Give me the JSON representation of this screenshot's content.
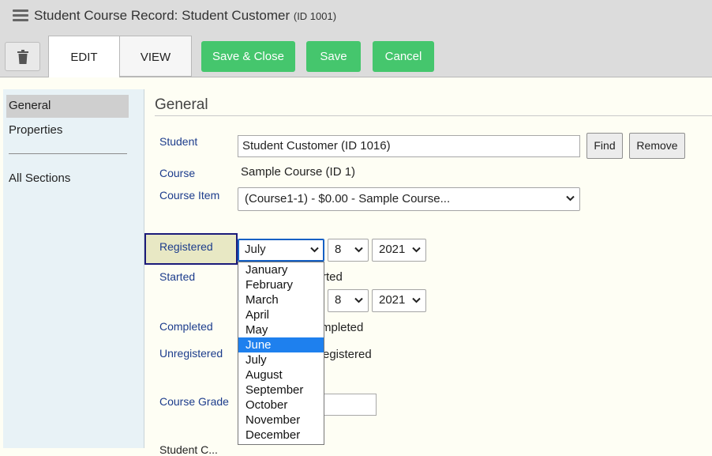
{
  "window": {
    "title": "Student Course Record: Student Customer",
    "title_id": "(ID 1001)"
  },
  "toolbar": {
    "tabs": [
      {
        "label": "EDIT",
        "active": true
      },
      {
        "label": "VIEW",
        "active": false
      }
    ],
    "save_close_label": "Save & Close",
    "save_label": "Save",
    "cancel_label": "Cancel",
    "accent_color": "#45c66d"
  },
  "sidebar": {
    "items": [
      {
        "label": "General",
        "active": true
      },
      {
        "label": "Properties",
        "active": false
      },
      {
        "label": "All Sections",
        "active": false
      }
    ]
  },
  "main": {
    "section_title": "General",
    "student": {
      "label": "Student",
      "value": "Student Customer (ID 1016)",
      "find_label": "Find",
      "remove_label": "Remove"
    },
    "course": {
      "label": "Course",
      "value": "Sample Course (ID 1)"
    },
    "course_item": {
      "label": "Course Item",
      "value": "(Course1-1) - $0.00 - Sample Course..."
    },
    "registered": {
      "label": "Registered",
      "month": "July",
      "day": "8",
      "year": "2021"
    },
    "started": {
      "label": "Started",
      "status_fragment": "rted",
      "day": "8",
      "year": "2021"
    },
    "completed": {
      "label": "Completed",
      "status_fragment": "mpleted"
    },
    "unregistered": {
      "label": "Unregistered",
      "status_fragment": "egistered"
    },
    "course_grade": {
      "label": "Course Grade",
      "value": ""
    },
    "cut_off_label": "Student C..."
  },
  "month_dropdown": {
    "options": [
      "January",
      "February",
      "March",
      "April",
      "May",
      "June",
      "July",
      "August",
      "September",
      "October",
      "November",
      "December"
    ],
    "highlighted": "June"
  }
}
